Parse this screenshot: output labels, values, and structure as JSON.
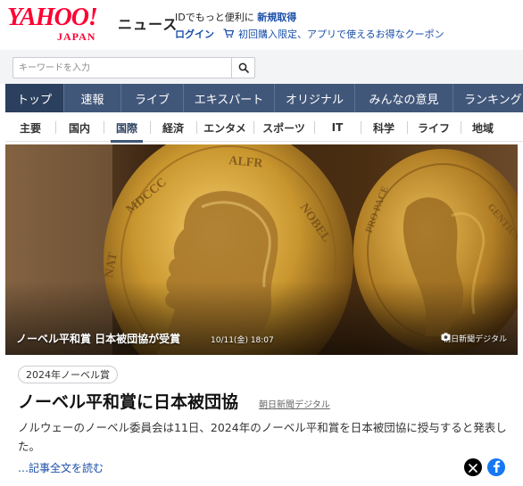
{
  "header": {
    "logo_main": "YAHOO!",
    "logo_sub": "JAPAN",
    "service_name": "ニュース",
    "promo_prefix": "IDでもっと便利に",
    "promo_register": "新規取得",
    "login_label": "ログイン",
    "coupon_text": "初回購入限定、アプリで使えるお得なクーポン"
  },
  "search": {
    "placeholder": "キーワードを入力",
    "icon": "search-icon"
  },
  "main_nav": {
    "items": [
      {
        "label": "トップ",
        "active": true
      },
      {
        "label": "速報"
      },
      {
        "label": "ライブ"
      },
      {
        "label": "エキスパート"
      },
      {
        "label": "オリジナル"
      },
      {
        "label": "みんなの意見"
      },
      {
        "label": "ランキング"
      }
    ]
  },
  "sub_nav": {
    "items": [
      {
        "label": "主要"
      },
      {
        "label": "国内"
      },
      {
        "label": "国際",
        "active": true
      },
      {
        "label": "経済"
      },
      {
        "label": "エンタメ"
      },
      {
        "label": "スポーツ"
      },
      {
        "label": "IT"
      },
      {
        "label": "科学"
      },
      {
        "label": "ライフ"
      },
      {
        "label": "地域"
      }
    ]
  },
  "hero": {
    "caption": "ノーベル平和賞 日本被団協が受賞",
    "date": "10/11(金) 18:07",
    "credit": "朝日新聞デジタル",
    "credit_icon": "camera-icon"
  },
  "article": {
    "tag": "2024年ノーベル賞",
    "title": "ノーベル平和賞に日本被団協",
    "source": "朝日新聞デジタル",
    "summary": "ノルウェーのノーベル委員会は11日、2024年のノーベル平和賞を日本被団協に授与すると発表した。",
    "read_more": "…記事全文を読む",
    "share_icons": [
      "x-icon",
      "facebook-icon"
    ]
  },
  "colors": {
    "brand_red": "#ff0033",
    "nav_bg": "#41577a",
    "nav_active": "#2b3f5e",
    "link_blue": "#1a4ea8",
    "medal_gold": "#c9962e"
  }
}
